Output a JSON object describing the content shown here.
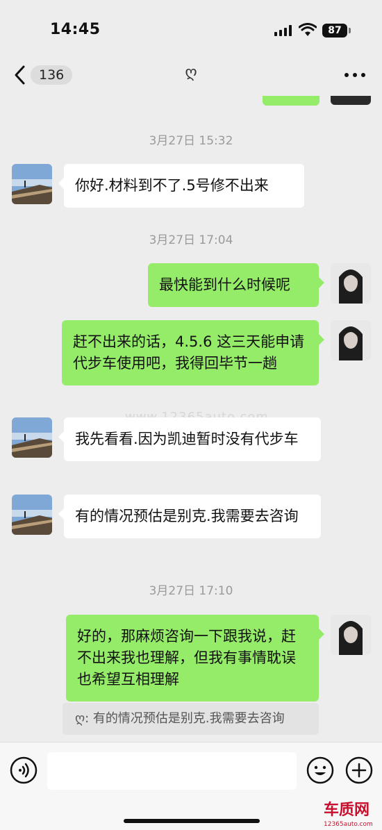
{
  "status_bar": {
    "time": "14:45",
    "battery": "87"
  },
  "nav": {
    "unread_count": "136",
    "title": "ღ"
  },
  "messages": [
    {
      "type": "timestamp",
      "text": "3月27日 15:32"
    },
    {
      "type": "incoming",
      "text": "你好.材料到不了.5号修不出来"
    },
    {
      "type": "timestamp",
      "text": "3月27日 17:04"
    },
    {
      "type": "outgoing",
      "text": "最快能到什么时候呢"
    },
    {
      "type": "outgoing",
      "text": "赶不出来的话，4.5.6 这三天能申请代步车使用吧，我得回毕节一趟"
    },
    {
      "type": "incoming",
      "text": "我先看看.因为凯迪暂时没有代步车"
    },
    {
      "type": "incoming",
      "text": "有的情况预估是别克.我需要去咨询"
    },
    {
      "type": "timestamp",
      "text": "3月27日 17:10"
    },
    {
      "type": "outgoing",
      "text": "好的，那麻烦咨询一下跟我说，赶不出来我也理解，但我有事情耽误也希望互相理解"
    }
  ],
  "quote": {
    "text": "ღ: 有的情况预估是别克.我需要去咨询"
  },
  "watermark": "www.12365auto.com",
  "brand": {
    "name": "车质网",
    "url": "12365auto.com"
  },
  "colors": {
    "outgoing_bubble": "#95ec69",
    "incoming_bubble": "#ffffff",
    "background": "#ededed"
  },
  "icons": [
    "chevron-left-icon",
    "more-icon",
    "voice-icon",
    "emoji-icon",
    "plus-icon",
    "signal-icon",
    "wifi-icon"
  ]
}
